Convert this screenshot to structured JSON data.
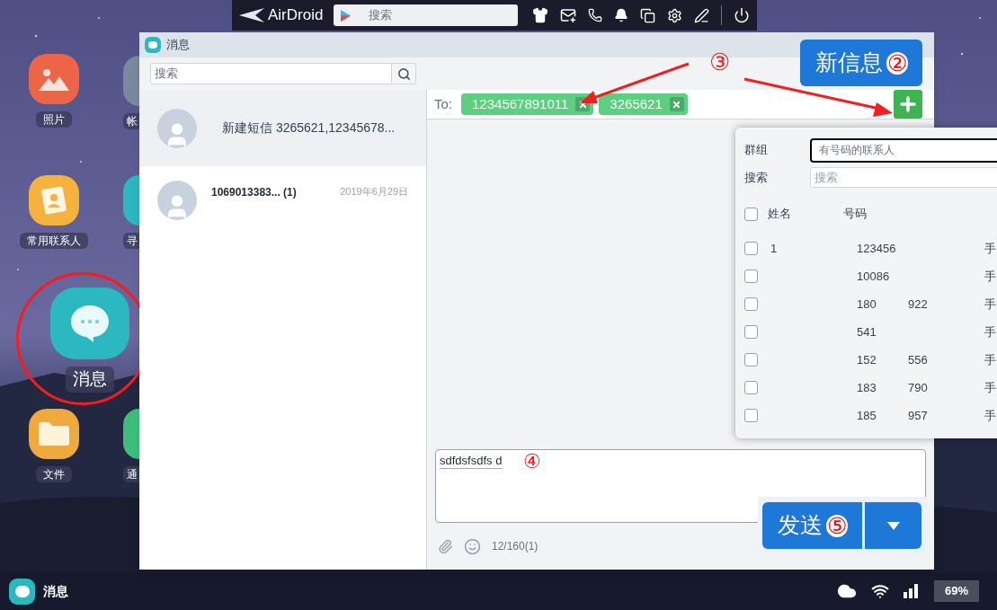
{
  "toolbar": {
    "logo": "AirDroid",
    "search": {
      "placeholder": "搜索"
    }
  },
  "desktop_icons": [
    {
      "label": "照片",
      "kind": "photos",
      "circled": false
    },
    {
      "label": "常用联系人",
      "kind": "contacts",
      "circled": false
    },
    {
      "label": "消息",
      "kind": "messages",
      "circled": true
    },
    {
      "label": "文件",
      "kind": "files",
      "circled": false
    }
  ],
  "desktop_icons_cut": [
    {
      "label": "帐",
      "kind": "gray"
    },
    {
      "label": "寻",
      "kind": "teal"
    },
    {
      "label": "通",
      "kind": "green"
    }
  ],
  "window": {
    "title": "消息"
  },
  "search": {
    "placeholder": "搜索"
  },
  "conversations": [
    {
      "title": "新建短信 3265621,12345678...",
      "selected": true
    },
    {
      "title": "1069013383... (1)",
      "date": "2019年6月29日",
      "selected": false
    }
  ],
  "recipients": {
    "label": "To:",
    "chips": [
      "1234567891011",
      "3265621"
    ],
    "marker": "③"
  },
  "new_message_button": {
    "label": "新信息",
    "marker": "②"
  },
  "contact_picker": {
    "group_label": "群组",
    "group_value": "有号码的联系人",
    "search_label": "搜索",
    "search_placeholder": "搜索",
    "all_checked": false,
    "columns": [
      "姓名",
      "号码"
    ],
    "rows": [
      {
        "checked": false,
        "name": "1",
        "number": "123456",
        "type": "手"
      },
      {
        "checked": false,
        "number": "10086",
        "type": "手"
      },
      {
        "checked": false,
        "number": "180",
        "number_end": "922",
        "type": "手"
      },
      {
        "checked": false,
        "number": "541",
        "type": "手"
      },
      {
        "checked": false,
        "number": "152",
        "number_end": "556",
        "type": "手"
      },
      {
        "checked": false,
        "number": "183",
        "number_end": "790",
        "type": "手"
      },
      {
        "checked": false,
        "number": "185",
        "number_end": "957",
        "type": "手"
      }
    ]
  },
  "composer": {
    "value": "sdfdsfsdfs d",
    "marker": "④",
    "counter": "12/160(1)"
  },
  "send_button": {
    "label": "发送",
    "marker": "⑤"
  },
  "taskbar": {
    "app": "消息",
    "battery": "69%"
  }
}
